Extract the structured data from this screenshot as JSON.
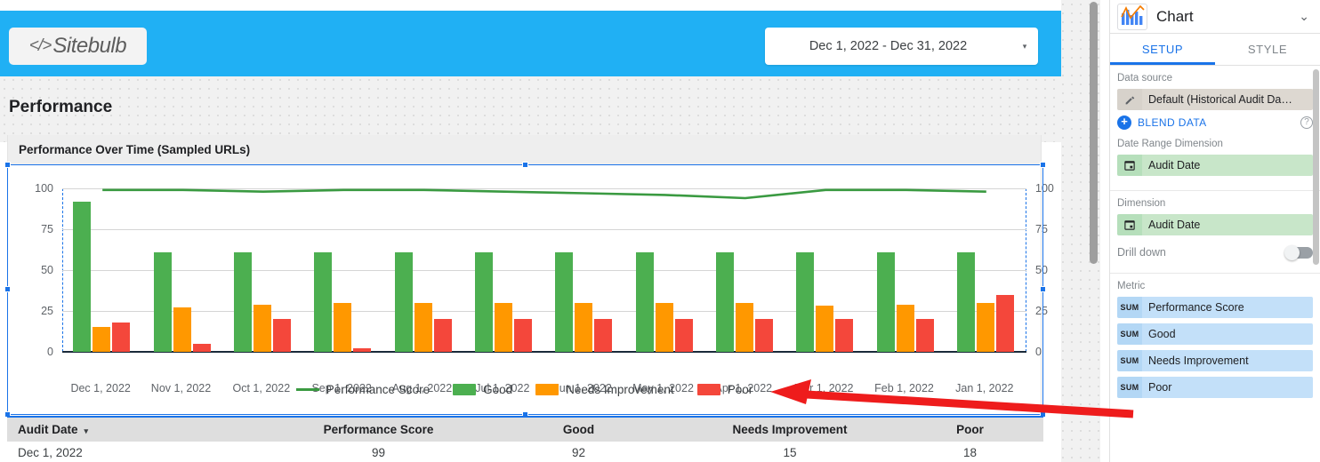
{
  "report": {
    "logo": {
      "code_mark": "</>",
      "word": "Sitebulb"
    },
    "date_range": {
      "value": "Dec 1, 2022 - Dec 31, 2022",
      "caret": "▾"
    },
    "page_title": "Performance",
    "chart_card_title": "Performance Over Time (Sampled URLs)"
  },
  "chart_data": {
    "type": "bar",
    "title": "Performance Over Time (Sampled URLs)",
    "xlabel": "",
    "ylabel": "",
    "ylim": [
      0,
      100
    ],
    "yticks": [
      0,
      25,
      50,
      75,
      100
    ],
    "grid": true,
    "legend_position": "bottom",
    "dual_axis": true,
    "categories": [
      "Dec 1, 2022",
      "Nov 1, 2022",
      "Oct 1, 2022",
      "Sep 1, 2022",
      "Aug 1, 2022",
      "Jul 1, 2022",
      "Jun 1, 2022",
      "May 1, 2022",
      "Apr 1, 2022",
      "Mar 1, 2022",
      "Feb 1, 2022",
      "Jan 1, 2022"
    ],
    "series": [
      {
        "name": "Performance Score",
        "type": "line",
        "color": "#3a9a41",
        "values": [
          99,
          99,
          98,
          99,
          99,
          98,
          97,
          96,
          94,
          99,
          99,
          98
        ]
      },
      {
        "name": "Good",
        "type": "bar",
        "color": "#4CAF50",
        "values": [
          92,
          61,
          61,
          61,
          61,
          61,
          61,
          61,
          61,
          61,
          61,
          61
        ]
      },
      {
        "name": "Needs Improvement",
        "type": "bar",
        "color": "#FF9800",
        "values": [
          15,
          27,
          29,
          30,
          30,
          30,
          30,
          30,
          30,
          28,
          29,
          30
        ]
      },
      {
        "name": "Poor",
        "type": "bar",
        "color": "#F4473B",
        "values": [
          18,
          5,
          20,
          2,
          20,
          20,
          20,
          20,
          20,
          20,
          20,
          35
        ]
      }
    ]
  },
  "table": {
    "columns": [
      "Audit Date",
      "Performance Score",
      "Good",
      "Needs Improvement",
      "Poor"
    ],
    "sort_caret": "▾",
    "rows": [
      [
        "Dec 1, 2022",
        "99",
        "92",
        "15",
        "18"
      ]
    ]
  },
  "panel": {
    "title": "Chart",
    "collapse_caret": "⌄",
    "tabs": [
      {
        "label": "SETUP",
        "active": true
      },
      {
        "label": "STYLE",
        "active": false
      }
    ],
    "data_source": {
      "section_label": "Data source",
      "value": "Default (Historical Audit Da…",
      "edit_icon": "pencil-icon",
      "blend_label": "BLEND DATA",
      "blend_plus": "+",
      "help": "?"
    },
    "date_range_dimension": {
      "section_label": "Date Range Dimension",
      "value": "Audit Date",
      "icon": "calendar-icon"
    },
    "dimension": {
      "section_label": "Dimension",
      "value": "Audit Date",
      "icon": "calendar-icon",
      "drill_down_label": "Drill down",
      "drill_down_on": false
    },
    "metric": {
      "section_label": "Metric",
      "items": [
        {
          "agg": "SUM",
          "name": "Performance Score"
        },
        {
          "agg": "SUM",
          "name": "Good"
        },
        {
          "agg": "SUM",
          "name": "Needs Improvement"
        },
        {
          "agg": "SUM",
          "name": "Poor"
        }
      ]
    }
  },
  "colors": {
    "brand_blue": "#20b0f4",
    "accent_blue": "#1a73e8",
    "good": "#4CAF50",
    "needs_improvement": "#FF9800",
    "poor": "#F4473B",
    "line": "#3a9a41",
    "annotation_red": "#ee1c1c"
  }
}
